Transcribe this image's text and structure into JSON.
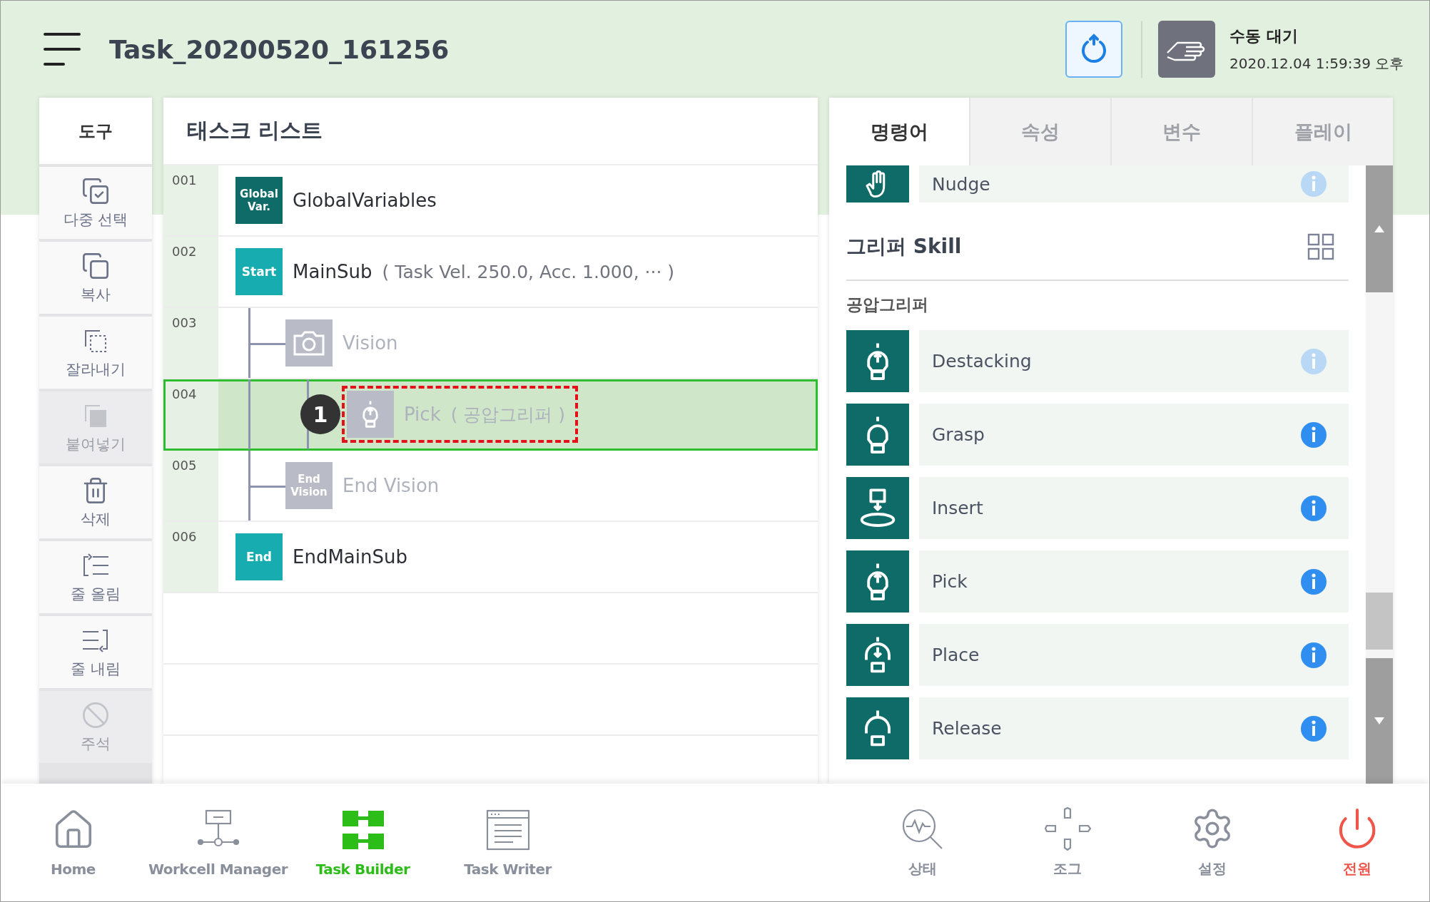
{
  "header": {
    "title": "Task_20200520_161256",
    "status": "수동 대기",
    "datetime": "2020.12.04 1:59:39 오후"
  },
  "tools": {
    "title": "도구",
    "items": [
      {
        "label": "다중 선택",
        "kind": "multi",
        "disabled": false
      },
      {
        "label": "복사",
        "kind": "copy",
        "disabled": false
      },
      {
        "label": "잘라내기",
        "kind": "cut",
        "disabled": false
      },
      {
        "label": "붙여넣기",
        "kind": "paste",
        "disabled": true
      },
      {
        "label": "삭제",
        "kind": "delete",
        "disabled": false
      },
      {
        "label": "줄 올림",
        "kind": "up",
        "disabled": false
      },
      {
        "label": "줄 내림",
        "kind": "down",
        "disabled": false
      },
      {
        "label": "주석",
        "kind": "comment",
        "disabled": true
      }
    ]
  },
  "task_list": {
    "title": "태스크 리스트",
    "rows": [
      {
        "number": "001",
        "kind": "global",
        "icon_text": "Global Var.",
        "label": "GlobalVariables",
        "disabled": false,
        "selected": false
      },
      {
        "number": "002",
        "kind": "start",
        "icon_text": "Start",
        "label": "MainSub",
        "params": "( Task Vel. 250.0, Acc. 1.000, ··· )",
        "disabled": false,
        "selected": false,
        "children": [
          {
            "number": "003",
            "kind": "vision",
            "label": "Vision",
            "disabled": true,
            "selected": false,
            "children": [
              {
                "number": "004",
                "kind": "pick",
                "label": "Pick",
                "params": "( 공압그리퍼 )",
                "disabled": true,
                "selected": true,
                "callout": "1"
              }
            ]
          },
          {
            "number": "005",
            "kind": "endvision",
            "icon_text": "End Vision",
            "label": "End Vision",
            "disabled": true,
            "selected": false
          }
        ]
      },
      {
        "number": "006",
        "kind": "end",
        "icon_text": "End",
        "label": "EndMainSub",
        "disabled": false,
        "selected": false
      }
    ]
  },
  "panel": {
    "tabs": [
      {
        "label": "명령어",
        "selected": true
      },
      {
        "label": "속성",
        "selected": false
      },
      {
        "label": "변수",
        "selected": false
      },
      {
        "label": "플레이",
        "selected": false
      }
    ],
    "top_item": {
      "name": "Nudge",
      "kind": "nudge",
      "info_enabled": false
    },
    "section": {
      "title": "그리퍼 Skill",
      "group": "공압그리퍼",
      "items": [
        {
          "name": "Destacking",
          "kind": "destack",
          "info_enabled": false
        },
        {
          "name": "Grasp",
          "kind": "grasp",
          "info_enabled": true
        },
        {
          "name": "Insert",
          "kind": "insert",
          "info_enabled": true
        },
        {
          "name": "Pick",
          "kind": "pick",
          "info_enabled": true
        },
        {
          "name": "Place",
          "kind": "place",
          "info_enabled": true
        },
        {
          "name": "Release",
          "kind": "release",
          "info_enabled": true
        }
      ]
    }
  },
  "nav": {
    "left": [
      {
        "label": "Home",
        "kind": "home",
        "selected": false
      },
      {
        "label": "Workcell Manager",
        "kind": "workcell",
        "selected": false
      },
      {
        "label": "Task Builder",
        "kind": "builder",
        "selected": true
      },
      {
        "label": "Task Writer",
        "kind": "writer",
        "selected": false
      }
    ],
    "right": [
      {
        "label": "상태",
        "kind": "status",
        "selected": false
      },
      {
        "label": "조그",
        "kind": "jog",
        "selected": false
      },
      {
        "label": "설정",
        "kind": "settings",
        "selected": false
      },
      {
        "label": "전원",
        "kind": "power",
        "selected": false
      }
    ]
  }
}
